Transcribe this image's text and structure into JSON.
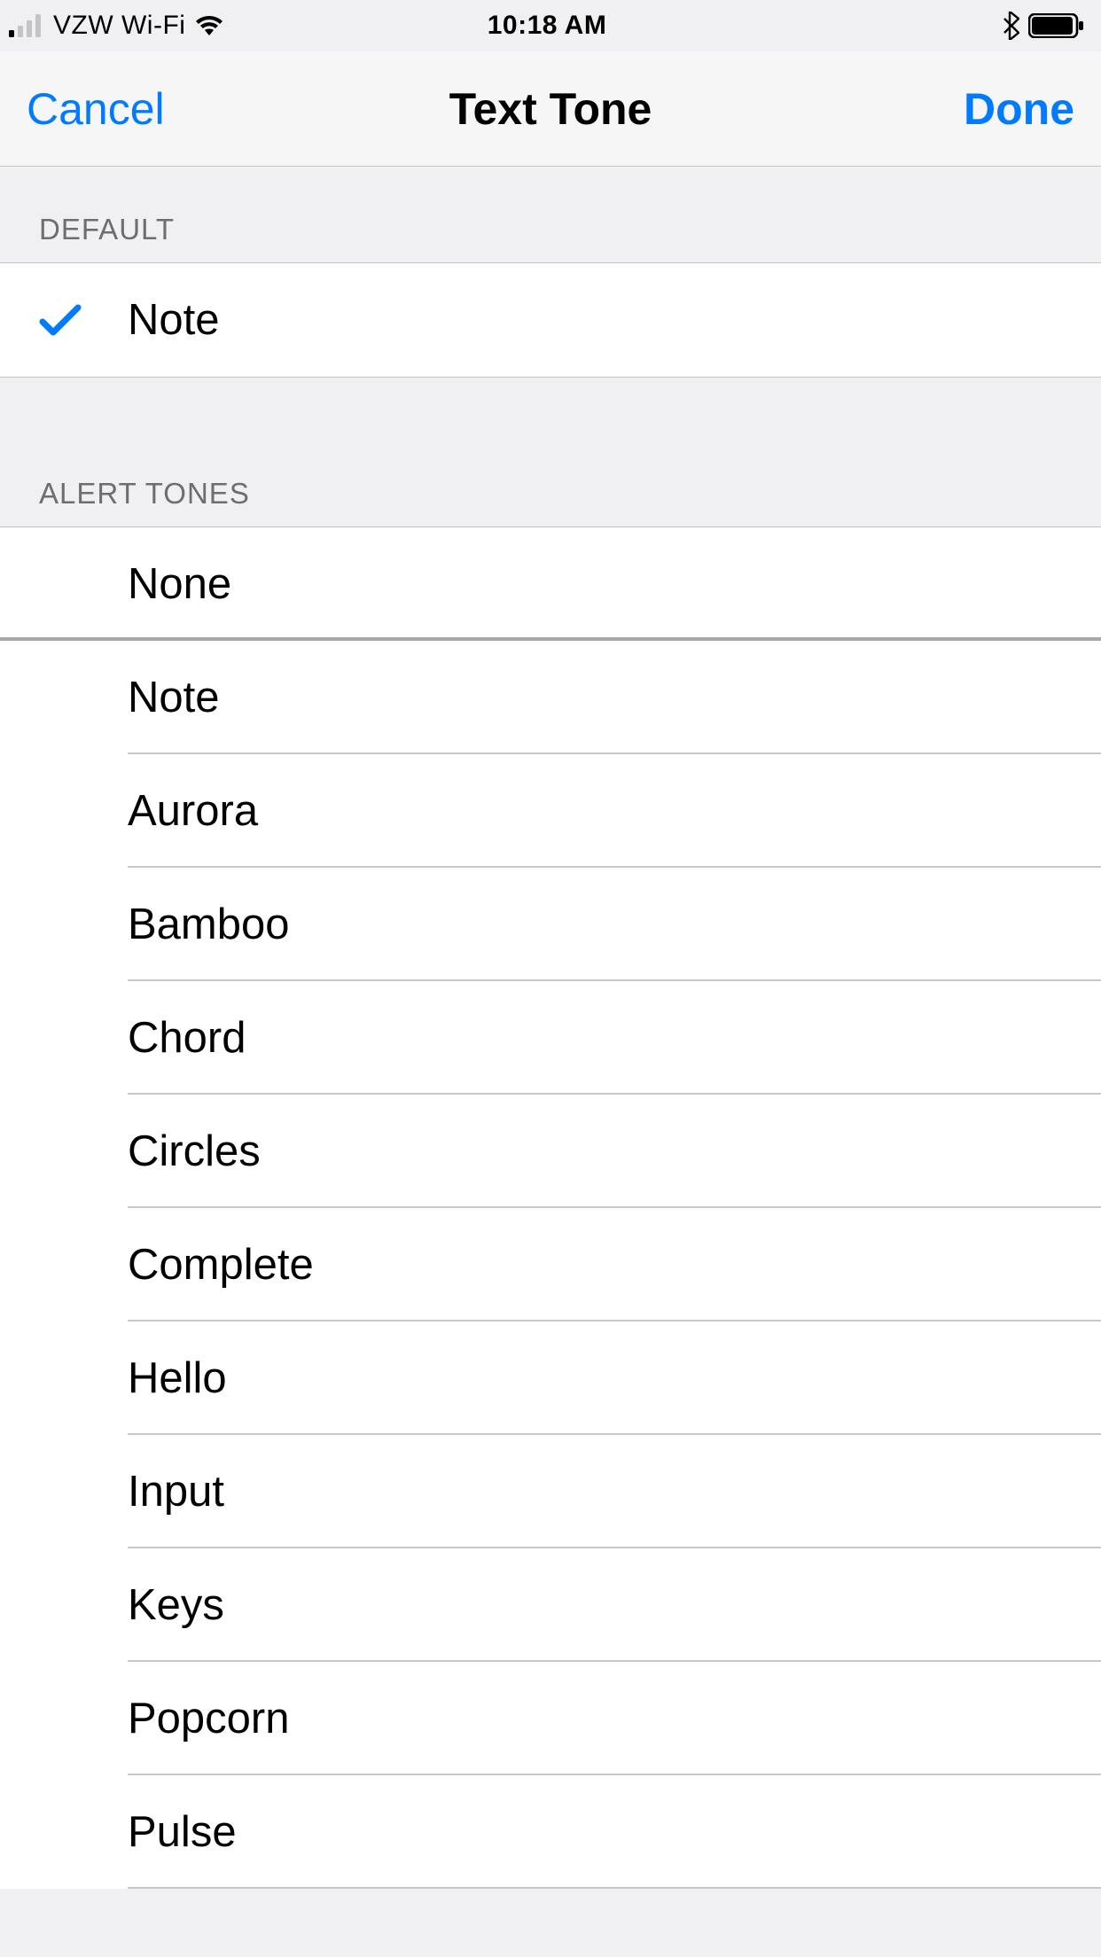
{
  "status_bar": {
    "carrier": "VZW Wi-Fi",
    "time": "10:18 AM"
  },
  "nav": {
    "cancel": "Cancel",
    "title": "Text Tone",
    "done": "Done"
  },
  "sections": {
    "default": {
      "header": "DEFAULT",
      "item": "Note"
    },
    "alert": {
      "header": "ALERT TONES",
      "none": "None",
      "items": [
        "Note",
        "Aurora",
        "Bamboo",
        "Chord",
        "Circles",
        "Complete",
        "Hello",
        "Input",
        "Keys",
        "Popcorn",
        "Pulse"
      ]
    }
  }
}
